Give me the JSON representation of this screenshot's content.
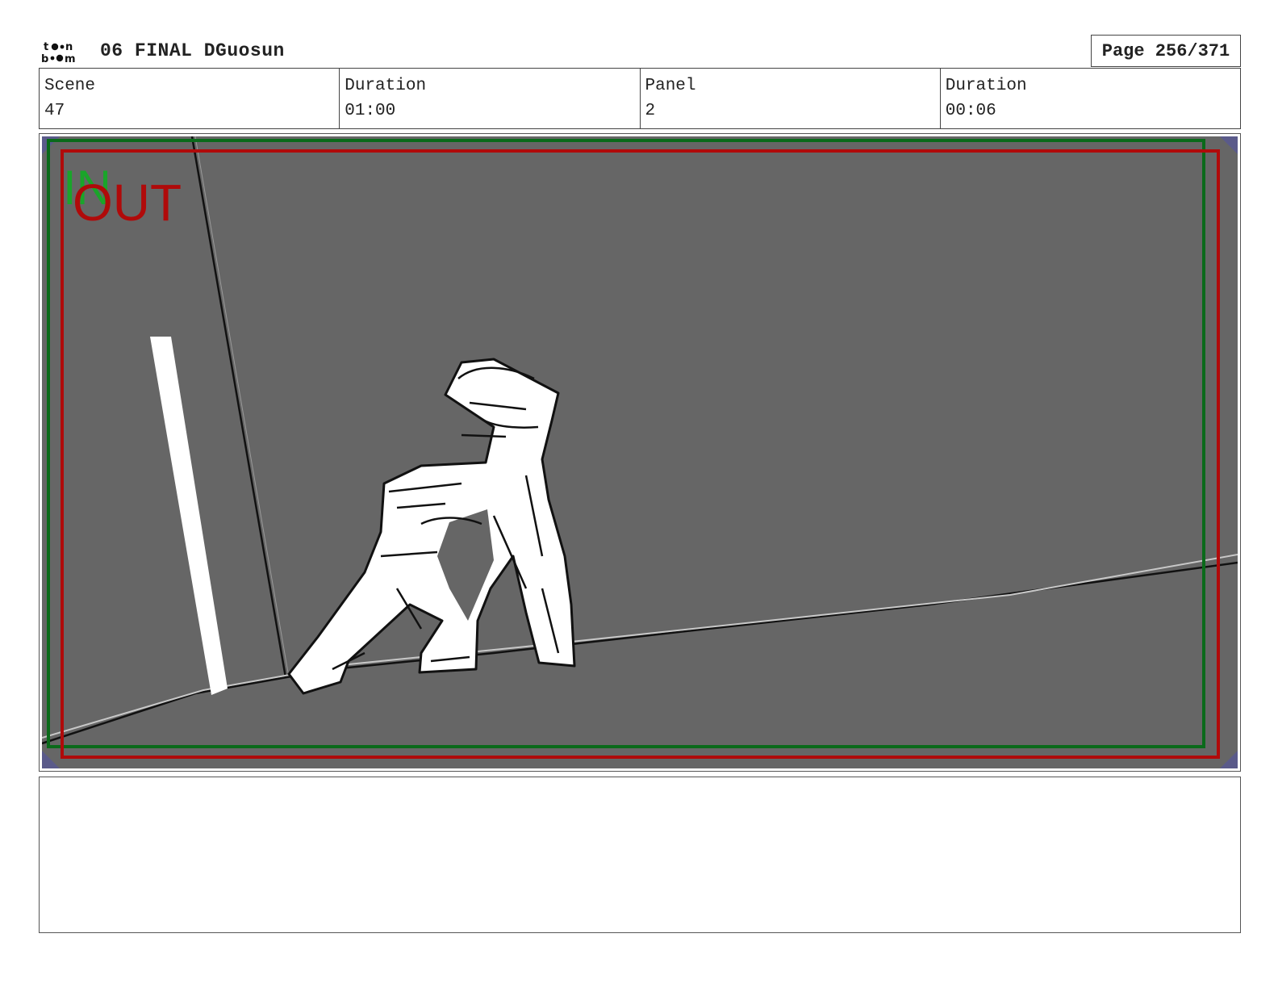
{
  "header": {
    "logo_text": "toon boom",
    "title": "06 FINAL DGuosun",
    "page_label": "Page 256/371"
  },
  "info": {
    "scene_label": "Scene",
    "scene_value": "47",
    "scene_duration_label": "Duration",
    "scene_duration_value": "01:00",
    "panel_label": "Panel",
    "panel_value": "2",
    "panel_duration_label": "Duration",
    "panel_duration_value": "00:06"
  },
  "panel": {
    "in_marker": "IN",
    "out_marker": "OUT",
    "background_color": "#666666",
    "in_frame_color": "#0a6a1a",
    "out_frame_color": "#b00a0a"
  },
  "notes": {
    "text": ""
  }
}
